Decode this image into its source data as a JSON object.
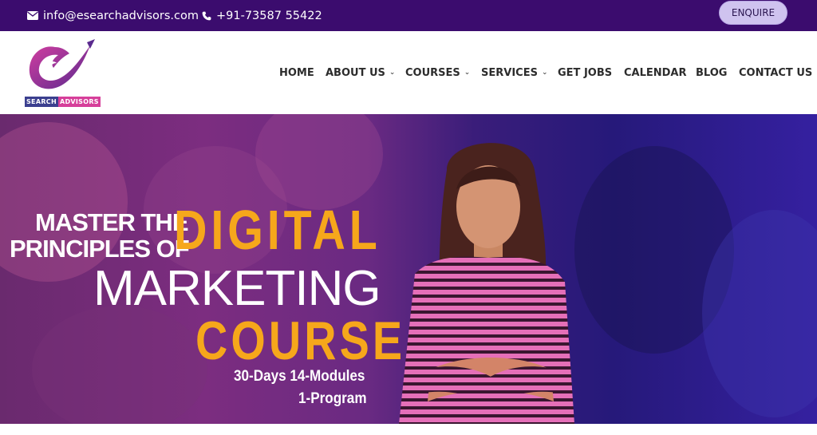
{
  "topbar": {
    "email": "info@esearchadvisors.com",
    "phone": "+91-73587 55422",
    "enquire_label": "ENQUIRE"
  },
  "logo": {
    "tag_left": "SEARCH",
    "tag_right": "ADVISORS"
  },
  "nav": {
    "items": [
      {
        "label": "HOME",
        "dropdown": false
      },
      {
        "label": "ABOUT US",
        "dropdown": true
      },
      {
        "label": "COURSES",
        "dropdown": true
      },
      {
        "label": "SERVICES",
        "dropdown": true
      },
      {
        "label": "GET JOBS",
        "dropdown": false
      },
      {
        "label": "CALENDAR",
        "dropdown": false
      },
      {
        "label": "BLOG",
        "dropdown": false
      },
      {
        "label": "CONTACT US",
        "dropdown": false
      }
    ]
  },
  "hero": {
    "line1": "MASTER THE",
    "line2": "PRINCIPLES OF",
    "highlight1": "DIGITAL",
    "line3": "MARKETING",
    "highlight2": "COURSE",
    "sub1": "30-Days 14-Modules",
    "sub2": "1-Program"
  },
  "colors": {
    "topbar_bg": "#3b0c6e",
    "gold": "#f6a71b",
    "enquire_bg": "#cfc3ef"
  }
}
